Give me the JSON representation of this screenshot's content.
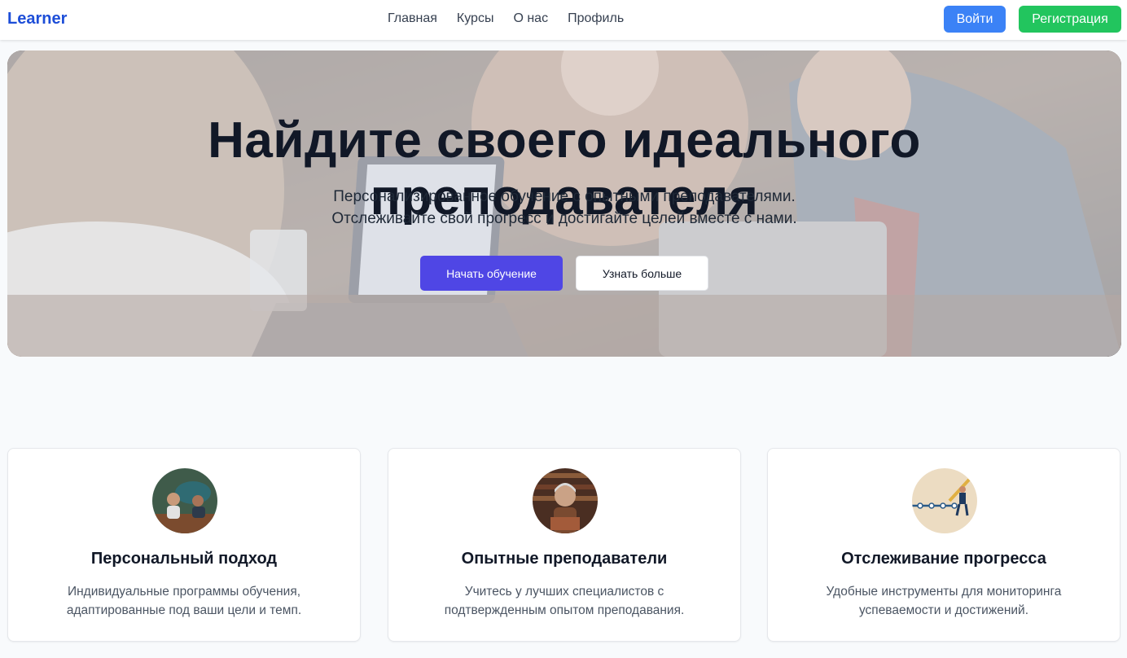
{
  "header": {
    "logo": "Learner",
    "nav": [
      {
        "label": "Главная"
      },
      {
        "label": "Курсы"
      },
      {
        "label": "О нас"
      },
      {
        "label": "Профиль"
      }
    ],
    "login_label": "Войти",
    "register_label": "Регистрация"
  },
  "hero": {
    "title": "Найдите своего идеального преподавателя",
    "subtitle_line1": "Персонализированное обучение с опытными преподавателями.",
    "subtitle_line2": "Отслеживайте свой прогресс и достигайте целей вместе с нами.",
    "primary_button": "Начать обучение",
    "secondary_button": "Узнать больше"
  },
  "features": [
    {
      "title": "Персональный подход",
      "text": "Индивидуальные программы обучения, адаптированные под ваши цели и темп."
    },
    {
      "title": "Опытные преподаватели",
      "text": "Учитесь у лучших специалистов с подтвержденным опытом преподавания."
    },
    {
      "title": "Отслеживание прогресса",
      "text": "Удобные инструменты для мониторинга успеваемости и достижений."
    }
  ],
  "colors": {
    "brand": "#1d4ed8",
    "login": "#3b82f6",
    "register": "#22c55e",
    "primary_cta": "#4f46e5"
  }
}
